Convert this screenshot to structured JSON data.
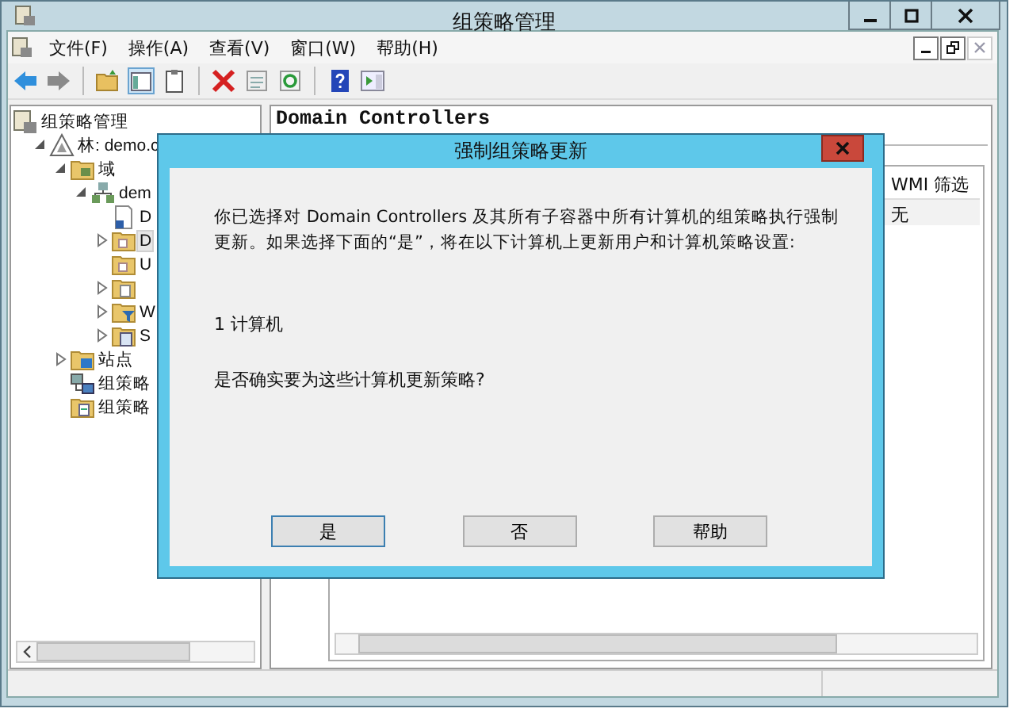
{
  "window": {
    "title": "组策略管理"
  },
  "menu": [
    {
      "label": "文件(F)"
    },
    {
      "label": "操作(A)"
    },
    {
      "label": "查看(V)"
    },
    {
      "label": "窗口(W)"
    },
    {
      "label": "帮助(H)"
    }
  ],
  "tree": [
    {
      "label": "组策略管理",
      "kind": "console",
      "selected": false,
      "children": [
        {
          "label": "林: demo.c",
          "kind": "forest",
          "expanded": true,
          "selected": false,
          "children": [
            {
              "label": "域",
              "kind": "folder",
              "expanded": true,
              "selected": false,
              "children": [
                {
                  "label": "dem",
                  "kind": "domain",
                  "expanded": true,
                  "selected": false,
                  "children": [
                    {
                      "label": "D",
                      "kind": "gpo",
                      "selected": false
                    },
                    {
                      "label": "D",
                      "kind": "ou",
                      "expanded": false,
                      "selected": true
                    },
                    {
                      "label": "U",
                      "kind": "ou",
                      "selected": false
                    },
                    {
                      "kind": "gpo-folder",
                      "expanded": false,
                      "selected": false
                    },
                    {
                      "label": "W",
                      "kind": "filter",
                      "expanded": false,
                      "selected": false
                    },
                    {
                      "label": "S",
                      "kind": "starter",
                      "expanded": false,
                      "selected": false
                    }
                  ]
                }
              ]
            },
            {
              "label": "站点",
              "kind": "sites",
              "expanded": false,
              "selected": false
            },
            {
              "label": "组策略",
              "kind": "modeling",
              "selected": false
            },
            {
              "label": "组策略",
              "kind": "results",
              "selected": false
            }
          ]
        }
      ]
    }
  ],
  "details": {
    "heading": "Domain Controllers",
    "columns": [
      {
        "label": "WMI 筛选"
      }
    ],
    "rows": [
      {
        "wmi_filter": "无"
      }
    ]
  },
  "dialog": {
    "title": "强制组策略更新",
    "message": "你已选择对 Domain Controllers 及其所有子容器中所有计算机的组策略执行强制更新。如果选择下面的“是”，将在以下计算机上更新用户和计算机策略设置:",
    "count": "1 计算机",
    "question": "是否确实要为这些计算机更新策略?",
    "buttons": [
      {
        "label": "是",
        "default": true
      },
      {
        "label": "否",
        "default": false
      },
      {
        "label": "帮助",
        "default": false
      }
    ]
  }
}
